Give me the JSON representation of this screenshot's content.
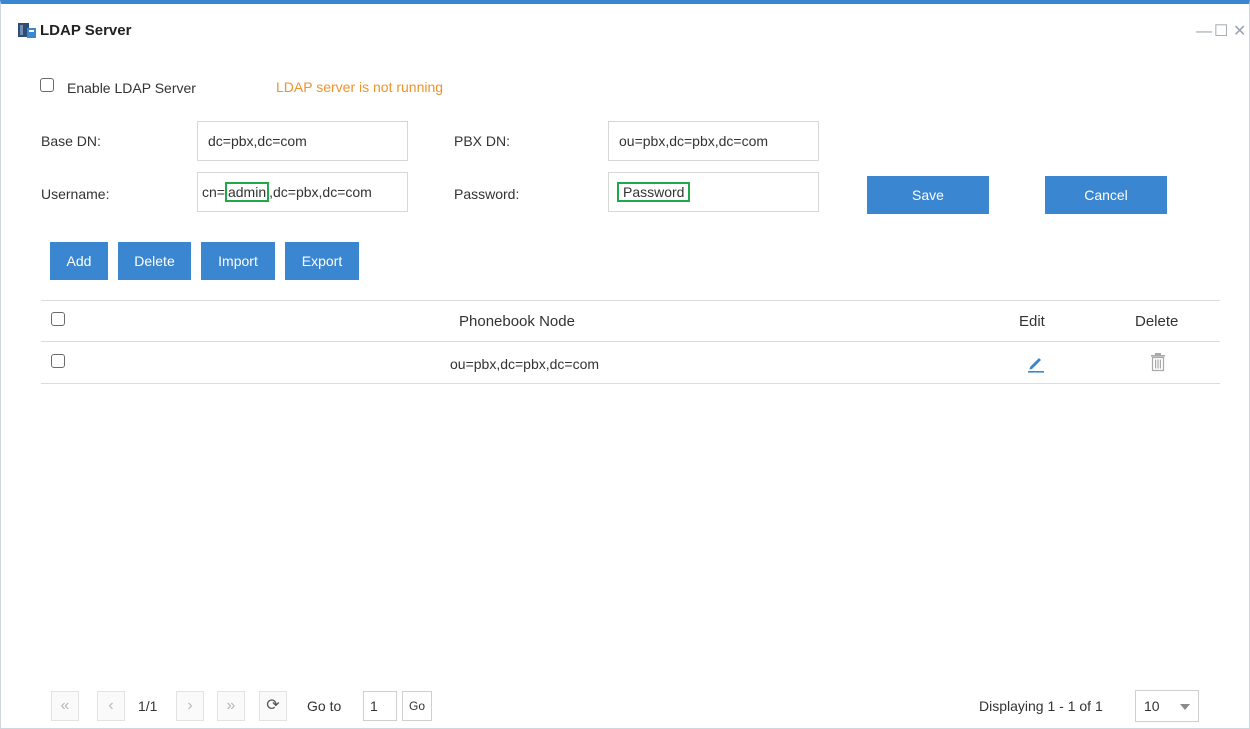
{
  "window": {
    "title": "LDAP Server",
    "controls": {
      "minimize": "—",
      "maximize": "☐",
      "close": "✕"
    }
  },
  "enable": {
    "label": "Enable LDAP Server",
    "checked": false,
    "status": "LDAP server is not running"
  },
  "form": {
    "base_dn_label": "Base DN:",
    "base_dn_value": "dc=pbx,dc=com",
    "pbx_dn_label": "PBX DN:",
    "pbx_dn_value": "ou=pbx,dc=pbx,dc=com",
    "username_label": "Username:",
    "username_prefix": "cn=",
    "username_highlight": "admin",
    "username_suffix": ",dc=pbx,dc=com",
    "password_label": "Password:",
    "password_value": "Password",
    "save_label": "Save",
    "cancel_label": "Cancel"
  },
  "toolbar": {
    "add": "Add",
    "delete": "Delete",
    "import": "Import",
    "export": "Export"
  },
  "table": {
    "headers": {
      "node": "Phonebook Node",
      "edit": "Edit",
      "delete": "Delete"
    },
    "rows": [
      {
        "node": "ou=pbx,dc=pbx,dc=com"
      }
    ]
  },
  "pager": {
    "page": "1/1",
    "goto_label": "Go to",
    "goto_value": "1",
    "go_label": "Go",
    "displaying": "Displaying 1 - 1 of 1",
    "page_size": "10"
  },
  "colors": {
    "accent": "#3a86d0",
    "status": "#f0932b",
    "highlight": "#22a84a"
  }
}
